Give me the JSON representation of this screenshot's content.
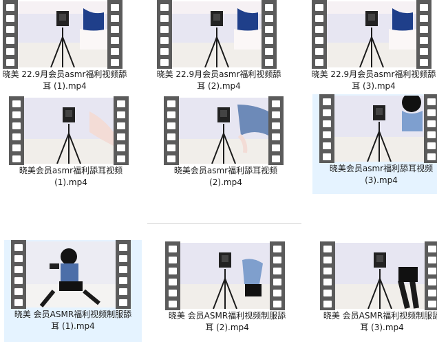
{
  "files": [
    {
      "name_line1": "晓美 22.9月会员asmr福利视频舔",
      "name_line2": "耳 (1).mp4",
      "selected": false
    },
    {
      "name_line1": "晓美 22.9月会员asmr福利视频舔",
      "name_line2": "耳 (2).mp4",
      "selected": false
    },
    {
      "name_line1": "晓美 22.9月会员asmr福利视频舔",
      "name_line2": "耳 (3).mp4",
      "selected": false
    },
    {
      "name_line1": "晓美会员asmr福利舔耳视频",
      "name_line2": "(1).mp4",
      "selected": false
    },
    {
      "name_line1": "晓美会员asmr福利舔耳视频",
      "name_line2": "(2).mp4",
      "selected": false
    },
    {
      "name_line1": "晓美会员asmr福利舔耳视频",
      "name_line2": "(3).mp4",
      "selected": true
    },
    {
      "name_line1": "晓美 会员ASMR福利视频制服舔",
      "name_line2": "耳 (1).mp4",
      "selected": true
    },
    {
      "name_line1": "晓美 会员ASMR福利视频制服舔",
      "name_line2": "耳 (2).mp4",
      "selected": false
    },
    {
      "name_line1": "晓美 会员ASMR福利视频制服舔",
      "name_line2": "耳 (3).mp4",
      "selected": false
    }
  ],
  "colors": {
    "selection": "#e5f3ff",
    "filmstrip": "#5b5b5b",
    "text": "#1a1a1a"
  },
  "icons": {
    "thumbnail_type": "video-filmstrip-icon"
  }
}
